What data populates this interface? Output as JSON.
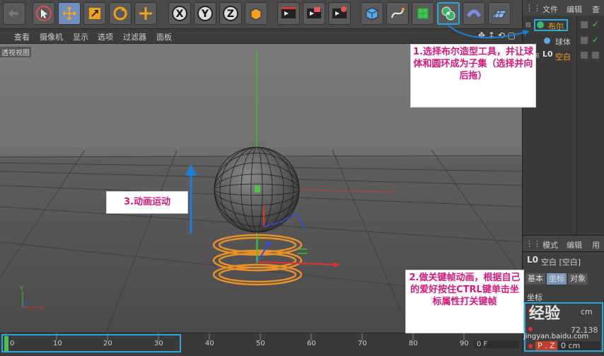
{
  "menubar": {
    "items": [
      "查看",
      "摄像机",
      "显示",
      "选项",
      "过滤器",
      "面板"
    ]
  },
  "viewport": {
    "label": "透视视图"
  },
  "toolbar": {
    "axis_x": "X",
    "axis_y": "Y",
    "axis_z": "Z"
  },
  "object_manager": {
    "menus": [
      "文件",
      "编辑",
      "查"
    ],
    "items": [
      {
        "name": "布尔",
        "color": "#f3a21b"
      },
      {
        "name": "球体",
        "color": "#cccccc"
      },
      {
        "name": "空白",
        "color": "#f3a21b"
      }
    ]
  },
  "attribute_manager": {
    "menus": [
      "模式",
      "编辑",
      "用"
    ],
    "object_label": "空白 [空白]",
    "tabs": [
      "基本",
      "坐标",
      "对象"
    ],
    "section": "坐标",
    "fields": [
      {
        "label": "P . Z",
        "value": "0 cm"
      },
      {
        "label": "",
        "value": "72.138"
      },
      {
        "label": "",
        "value": "cm"
      }
    ]
  },
  "timeline": {
    "ticks": [
      "0",
      "10",
      "20",
      "30",
      "40",
      "50",
      "60",
      "70",
      "80",
      "90"
    ],
    "frame": "0 F"
  },
  "annotations": {
    "note1": "1.选择布尔造型工具，并让球体和圆环成为子集（选择并向后拖）",
    "note2": "2.做关键帧动画，根据自己的爱好按住CTRL键单击坐标属性打关键帧",
    "note3": "3.动画运动"
  },
  "watermark": {
    "line1": "经验",
    "line2": "jingyan.baidu.com"
  },
  "colors": {
    "highlight": "#2aa8d8",
    "annotation_text": "#d6197a",
    "torus": "#e8902a",
    "axis_y": "#3cbc3c",
    "axis_x": "#d93030"
  }
}
